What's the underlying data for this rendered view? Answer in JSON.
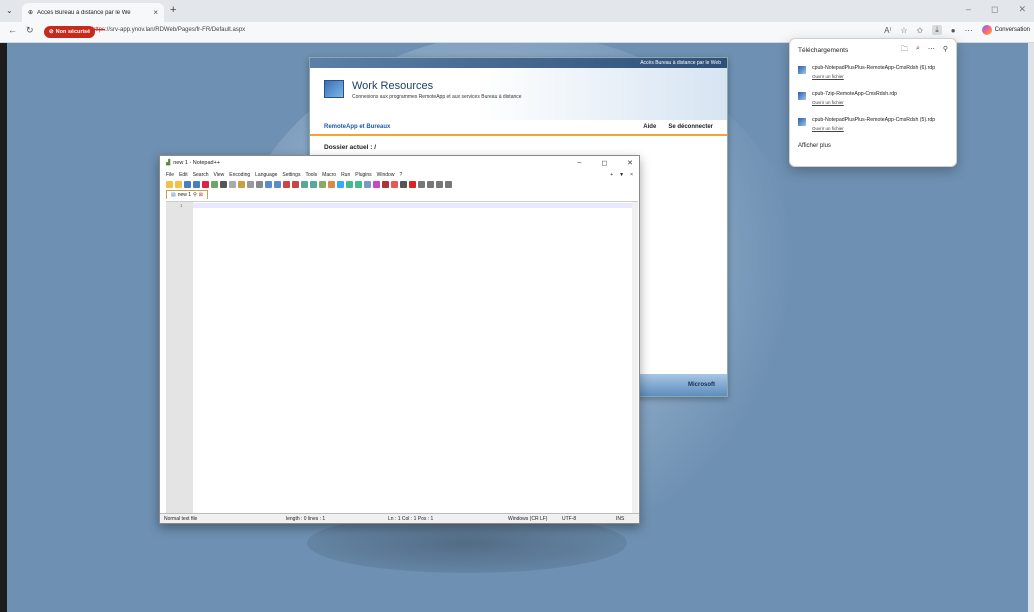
{
  "browser": {
    "tab_title": "Accès Bureau à distance par le We",
    "security_badge": "Non sécurisé",
    "url_scheme": "https",
    "url_rest": "://srv-app.ynov.lan/RDWeb/Pages/fr-FR/Default.aspx",
    "copilot_label": "Conversation"
  },
  "rdweb": {
    "top_banner": "Accès Bureau à distance par le Web",
    "title": "Work Resources",
    "subtitle": "Connexions aux programmes RemoteApp et aux services Bureau à distance",
    "nav_apps": "RemoteApp et Bureaux",
    "nav_help": "Aide",
    "nav_logout": "Se déconnecter",
    "current_folder": "Dossier actuel : /",
    "footer_brand": "Microsoft"
  },
  "notepad": {
    "title": "new 1 - Notepad++",
    "menu": [
      "File",
      "Edit",
      "Search",
      "View",
      "Encoding",
      "Language",
      "Settings",
      "Tools",
      "Macro",
      "Run",
      "Plugins",
      "Window",
      "?"
    ],
    "menu_right": [
      "+",
      "▼",
      "×"
    ],
    "tab_label": "new 1",
    "line_number": "1",
    "status": {
      "filetype": "Normal text file",
      "length": "length : 0   lines : 1",
      "position": "Ln : 1   Col : 1   Pos : 1",
      "eol": "Windows (CR LF)",
      "encoding": "UTF-8",
      "mode": "INS"
    }
  },
  "downloads": {
    "title": "Téléchargements",
    "items": [
      {
        "name": "cpub-NotepadPlusPlus-RemoteApp-CmsRdsh (6).rdp",
        "action": "Ouvrir un fichier"
      },
      {
        "name": "cpub-7zip-RemoteApp-CmsRdsh.rdp",
        "action": "Ouvrir un fichier"
      },
      {
        "name": "cpub-NotepadPlusPlus-RemoteApp-CmsRdsh (5).rdp",
        "action": "Ouvrir un fichier"
      }
    ],
    "more": "Afficher plus"
  }
}
